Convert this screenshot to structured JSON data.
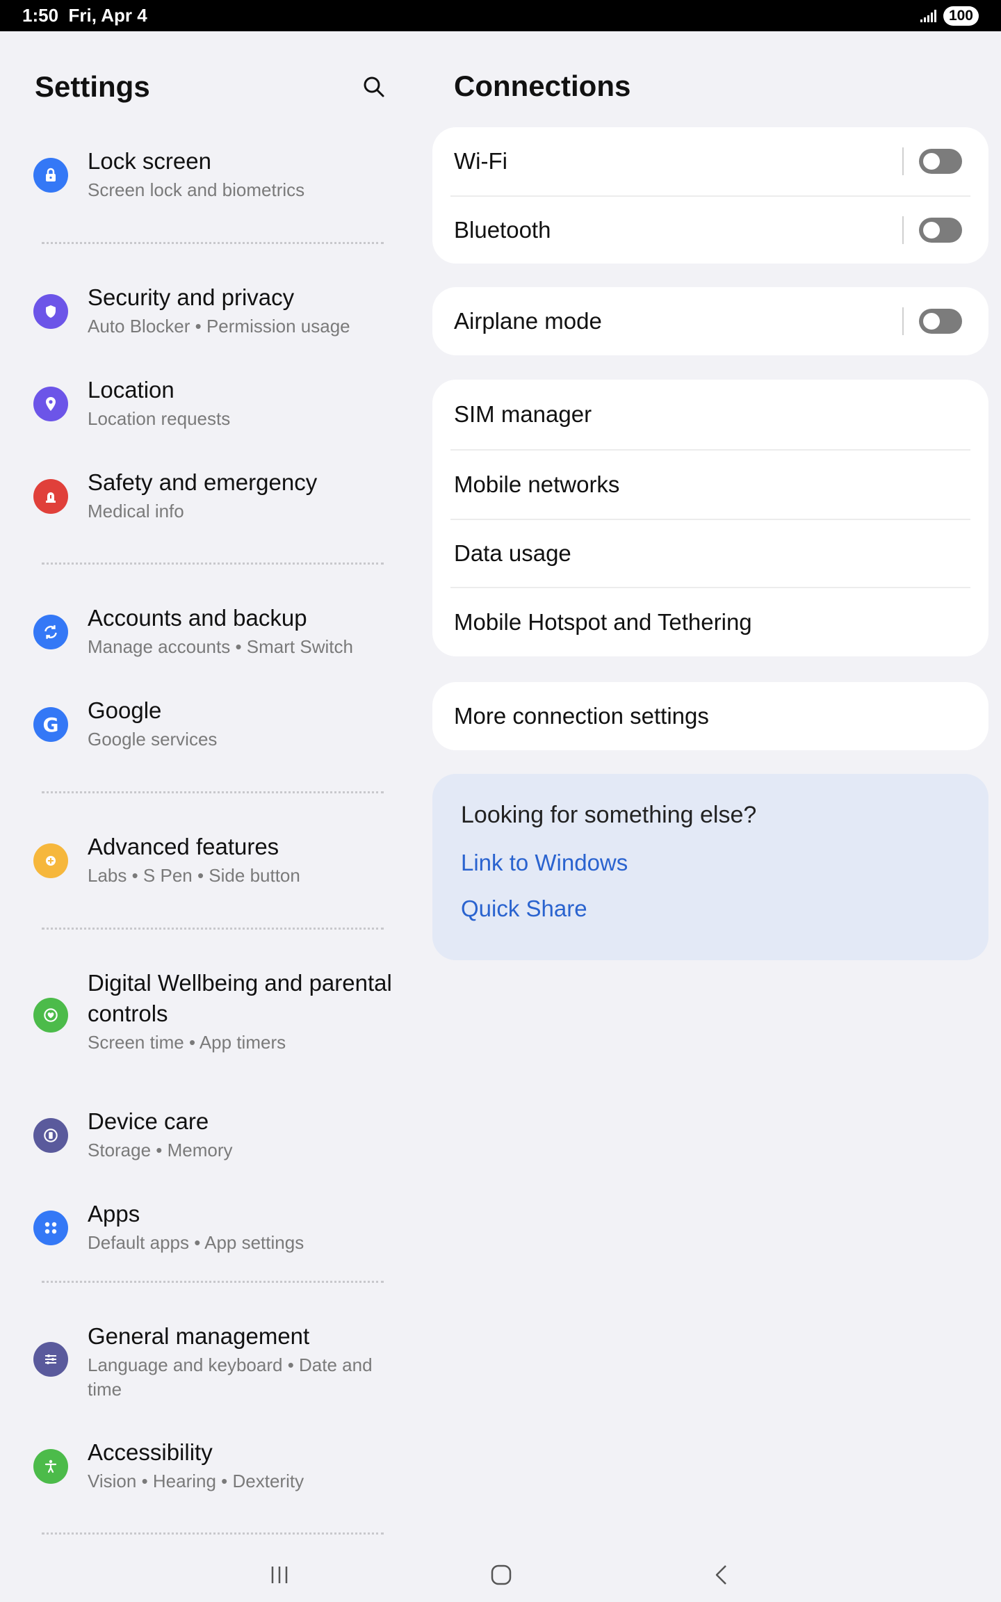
{
  "status_bar": {
    "time": "1:50",
    "date": "Fri, Apr 4",
    "battery": "100"
  },
  "settings": {
    "title": "Settings",
    "items": [
      {
        "title": "Lock screen",
        "subtitle": "Screen lock and biometrics",
        "icon": "lock-icon",
        "color": "#3478f6"
      },
      {
        "title": "Security and privacy",
        "subtitle": "Auto Blocker  •  Permission usage",
        "icon": "shield-icon",
        "color": "#6c55e8"
      },
      {
        "title": "Location",
        "subtitle": "Location requests",
        "icon": "location-pin-icon",
        "color": "#6c55e8"
      },
      {
        "title": "Safety and emergency",
        "subtitle": "Medical info",
        "icon": "alarm-icon",
        "color": "#e0403a"
      },
      {
        "title": "Accounts and backup",
        "subtitle": "Manage accounts  •  Smart Switch",
        "icon": "sync-icon",
        "color": "#3478f6"
      },
      {
        "title": "Google",
        "subtitle": "Google services",
        "icon": "google-icon",
        "color": "#3478f6"
      },
      {
        "title": "Advanced features",
        "subtitle": "Labs  •  S Pen  •  Side button",
        "icon": "gear-plus-icon",
        "color": "#f6b73c"
      },
      {
        "title": "Digital Wellbeing and parental controls",
        "subtitle": "Screen time  •  App timers",
        "icon": "wellbeing-icon",
        "color": "#4cbb4a"
      },
      {
        "title": "Device care",
        "subtitle": "Storage  •  Memory",
        "icon": "device-care-icon",
        "color": "#5a5a9c"
      },
      {
        "title": "Apps",
        "subtitle": "Default apps  •  App settings",
        "icon": "apps-grid-icon",
        "color": "#3478f6"
      },
      {
        "title": "General management",
        "subtitle": "Language and keyboard  •  Date and time",
        "icon": "sliders-icon",
        "color": "#5a5a9c"
      },
      {
        "title": "Accessibility",
        "subtitle": "Vision  •  Hearing  •  Dexterity",
        "icon": "accessibility-icon",
        "color": "#4cbb4a"
      }
    ]
  },
  "connections": {
    "title": "Connections",
    "wifi": {
      "label": "Wi-Fi",
      "enabled": false
    },
    "bluetooth": {
      "label": "Bluetooth",
      "enabled": false
    },
    "airplane": {
      "label": "Airplane mode",
      "enabled": false
    },
    "sim_manager": "SIM manager",
    "mobile_networks": "Mobile networks",
    "data_usage": "Data usage",
    "hotspot": "Mobile Hotspot and Tethering",
    "more": "More connection settings",
    "suggest": {
      "question": "Looking for something else?",
      "link1": "Link to Windows",
      "link2": "Quick Share"
    }
  }
}
